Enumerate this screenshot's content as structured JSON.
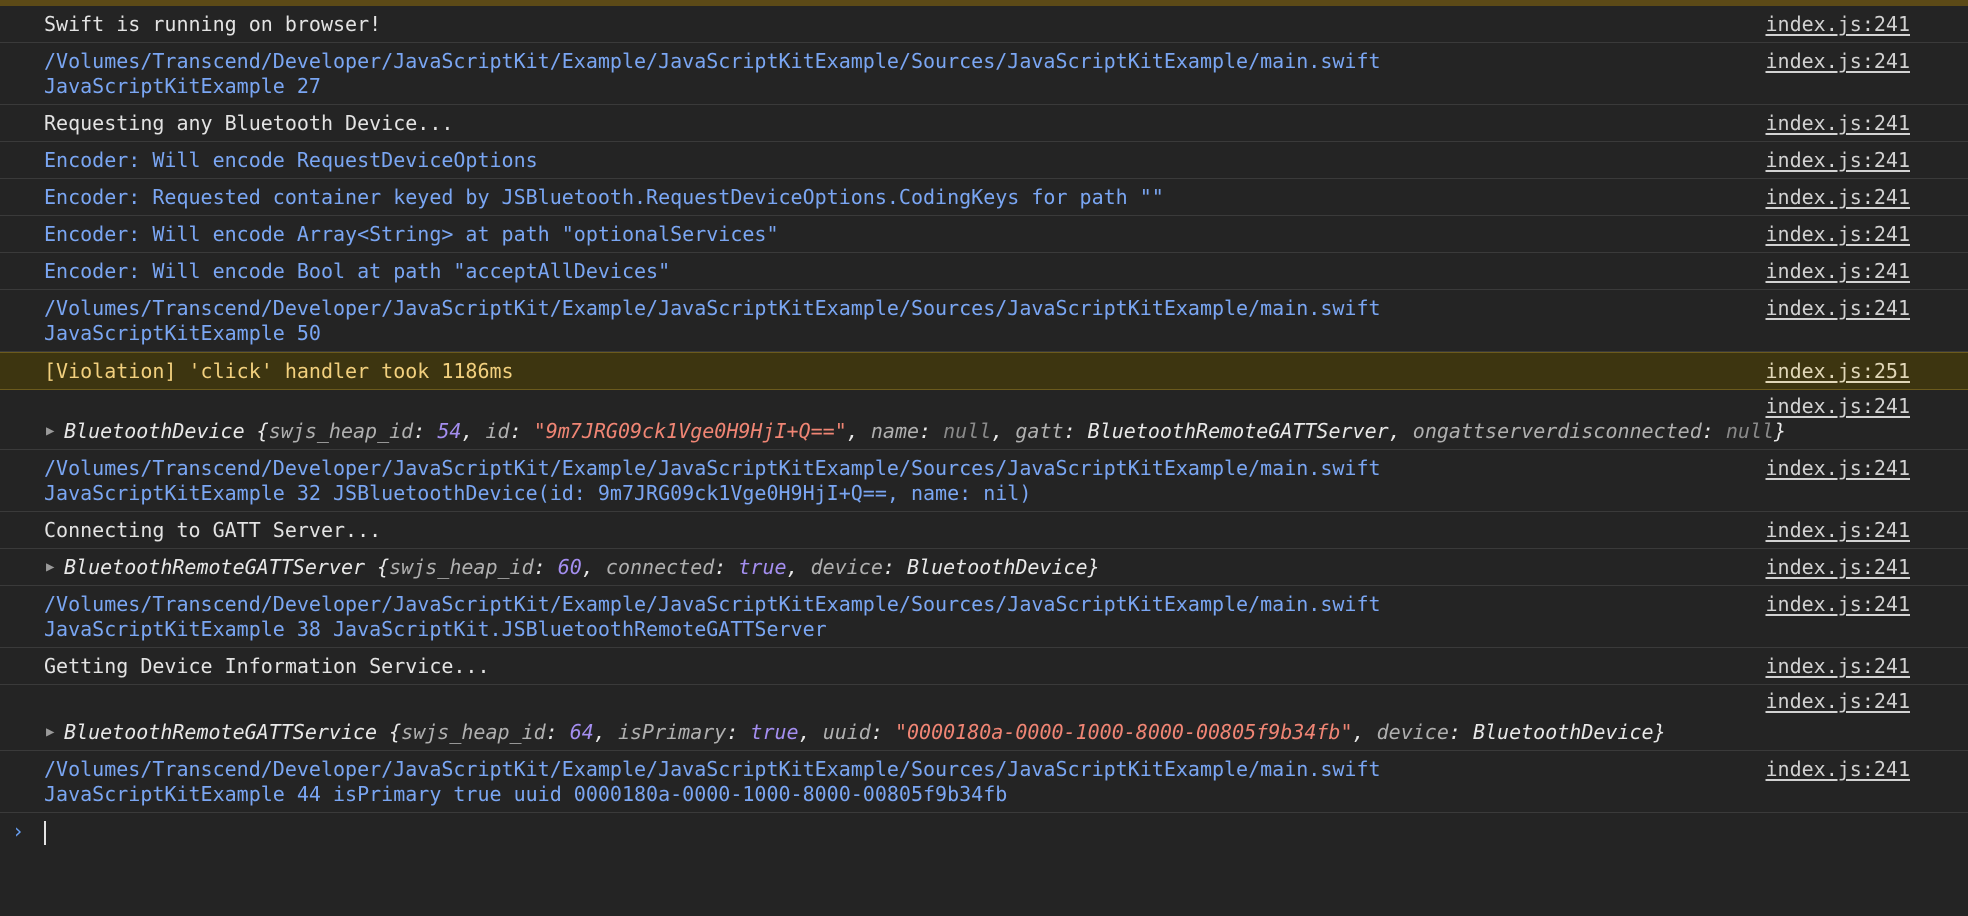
{
  "messages": {
    "m1": {
      "text": "Swift is running on browser!",
      "src": "index.js:241"
    },
    "m2": {
      "line1": "/Volumes/Transcend/Developer/JavaScriptKit/Example/JavaScriptKitExample/Sources/JavaScriptKitExample/main.swift",
      "line2": "JavaScriptKitExample 27",
      "src": "index.js:241"
    },
    "m3": {
      "text": "Requesting any Bluetooth Device...",
      "src": "index.js:241"
    },
    "m4": {
      "text": "Encoder: Will encode RequestDeviceOptions",
      "src": "index.js:241"
    },
    "m5": {
      "text": "Encoder: Requested container keyed by JSBluetooth.RequestDeviceOptions.CodingKeys for path \"\"",
      "src": "index.js:241"
    },
    "m6": {
      "text": "Encoder: Will encode Array<String> at path \"optionalServices\"",
      "src": "index.js:241"
    },
    "m7": {
      "text": "Encoder: Will encode Bool at path \"acceptAllDevices\"",
      "src": "index.js:241"
    },
    "m8": {
      "line1": "/Volumes/Transcend/Developer/JavaScriptKit/Example/JavaScriptKitExample/Sources/JavaScriptKitExample/main.swift",
      "line2": "JavaScriptKitExample 50",
      "src": "index.js:241"
    },
    "m9": {
      "text": "[Violation] 'click' handler took 1186ms",
      "src": "index.js:251"
    },
    "m10": {
      "src": "index.js:241",
      "cls": "BluetoothDevice",
      "open": " {",
      "k1": "swjs_heap_id",
      "v1": "54",
      "k2": "id",
      "v2": "\"9m7JRG09ck1Vge0H9HjI+Q==\"",
      "k3": "name",
      "v3": "null",
      "k4": "gatt",
      "v4": "BluetoothRemoteGATTServer",
      "k5": "ongattserverdisconnected",
      "v5": "null",
      "close": "}"
    },
    "m11": {
      "line1": "/Volumes/Transcend/Developer/JavaScriptKit/Example/JavaScriptKitExample/Sources/JavaScriptKitExample/main.swift",
      "line2": "JavaScriptKitExample 32 JSBluetoothDevice(id: 9m7JRG09ck1Vge0H9HjI+Q==, name: nil)",
      "src": "index.js:241"
    },
    "m12": {
      "text": "Connecting to GATT Server...",
      "src": "index.js:241"
    },
    "m13": {
      "src": "index.js:241",
      "cls": "BluetoothRemoteGATTServer",
      "open": " {",
      "k1": "swjs_heap_id",
      "v1": "60",
      "k2": "connected",
      "v2": "true",
      "k3": "device",
      "v3": "BluetoothDevice",
      "close": "}"
    },
    "m14": {
      "line1": "/Volumes/Transcend/Developer/JavaScriptKit/Example/JavaScriptKitExample/Sources/JavaScriptKitExample/main.swift",
      "line2": "JavaScriptKitExample 38 JavaScriptKit.JSBluetoothRemoteGATTServer",
      "src": "index.js:241"
    },
    "m15": {
      "text": "Getting Device Information Service...",
      "src": "index.js:241"
    },
    "m16": {
      "src": "index.js:241",
      "cls": "BluetoothRemoteGATTService",
      "open": " {",
      "k1": "swjs_heap_id",
      "v1": "64",
      "k2": "isPrimary",
      "v2": "true",
      "k3": "uuid",
      "v3": "\"0000180a-0000-1000-8000-00805f9b34fb\"",
      "k4": "device",
      "v4": "BluetoothDevice",
      "close": "}"
    },
    "m17": {
      "line1": "/Volumes/Transcend/Developer/JavaScriptKit/Example/JavaScriptKitExample/Sources/JavaScriptKitExample/main.swift",
      "line2": "JavaScriptKitExample 44 isPrimary true uuid 0000180a-0000-1000-8000-00805f9b34fb",
      "src": "index.js:241"
    }
  },
  "prompt": {
    "glyph": "›"
  },
  "colors": {
    "background": "#242424",
    "log_blue": "#7aa6f3",
    "violation_bg": "#3d3510",
    "violation_text": "#f2d07e",
    "number": "#a48ef0",
    "string": "#f08574"
  },
  "icons": {
    "expand": "expand-triangle-icon",
    "prompt": "prompt-chevron-icon"
  }
}
